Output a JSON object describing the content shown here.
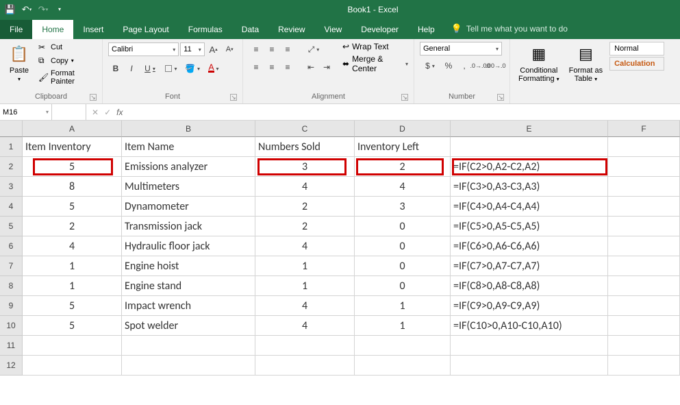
{
  "app": {
    "title": "Book1 - Excel"
  },
  "qat": {
    "save": "save",
    "undo": "undo",
    "redo": "redo"
  },
  "tabs": {
    "file": "File",
    "home": "Home",
    "insert": "Insert",
    "page_layout": "Page Layout",
    "formulas": "Formulas",
    "data": "Data",
    "review": "Review",
    "view": "View",
    "developer": "Developer",
    "help": "Help",
    "tellme": "Tell me what you want to do"
  },
  "ribbon": {
    "clipboard": {
      "label": "Clipboard",
      "paste": "Paste",
      "cut": "Cut",
      "copy": "Copy",
      "format_painter": "Format Painter"
    },
    "font": {
      "label": "Font",
      "name": "Calibri",
      "size": "11"
    },
    "alignment": {
      "label": "Alignment",
      "wrap": "Wrap Text",
      "merge": "Merge & Center"
    },
    "number": {
      "label": "Number",
      "format": "General"
    },
    "styles": {
      "conditional": "Conditional\nFormatting",
      "format_table": "Format as\nTable",
      "normal": "Normal",
      "calculation": "Calculation"
    }
  },
  "formulabar": {
    "namebox": "M16",
    "formula": ""
  },
  "sheet": {
    "cols": [
      "A",
      "B",
      "C",
      "D",
      "E",
      "F"
    ],
    "rows": [
      "1",
      "2",
      "3",
      "4",
      "5",
      "6",
      "7",
      "8",
      "9",
      "10",
      "11",
      "12"
    ],
    "headers": {
      "A1": "Item Inventory",
      "B1": "Item Name",
      "C1": "Numbers Sold",
      "D1": "Inventory Left"
    },
    "data": [
      {
        "a": "5",
        "b": "Emissions analyzer",
        "c": "3",
        "d": "2",
        "e": "=IF(C2>0,A2-C2,A2)"
      },
      {
        "a": "8",
        "b": "Multimeters",
        "c": "4",
        "d": "4",
        "e": "=IF(C3>0,A3-C3,A3)"
      },
      {
        "a": "5",
        "b": "Dynamometer",
        "c": "2",
        "d": "3",
        "e": "=IF(C4>0,A4-C4,A4)"
      },
      {
        "a": "2",
        "b": "Transmission jack",
        "c": "2",
        "d": "0",
        "e": "=IF(C5>0,A5-C5,A5)"
      },
      {
        "a": "4",
        "b": "Hydraulic floor jack",
        "c": "4",
        "d": "0",
        "e": "=IF(C6>0,A6-C6,A6)"
      },
      {
        "a": "1",
        "b": "Engine hoist",
        "c": "1",
        "d": "0",
        "e": "=IF(C7>0,A7-C7,A7)"
      },
      {
        "a": "1",
        "b": "Engine stand",
        "c": "1",
        "d": "0",
        "e": "=IF(C8>0,A8-C8,A8)"
      },
      {
        "a": "5",
        "b": "Impact wrench",
        "c": "4",
        "d": "1",
        "e": "=IF(C9>0,A9-C9,A9)"
      },
      {
        "a": "5",
        "b": "Spot welder",
        "c": "4",
        "d": "1",
        "e": "=IF(C10>0,A10-C10,A10)"
      }
    ]
  }
}
